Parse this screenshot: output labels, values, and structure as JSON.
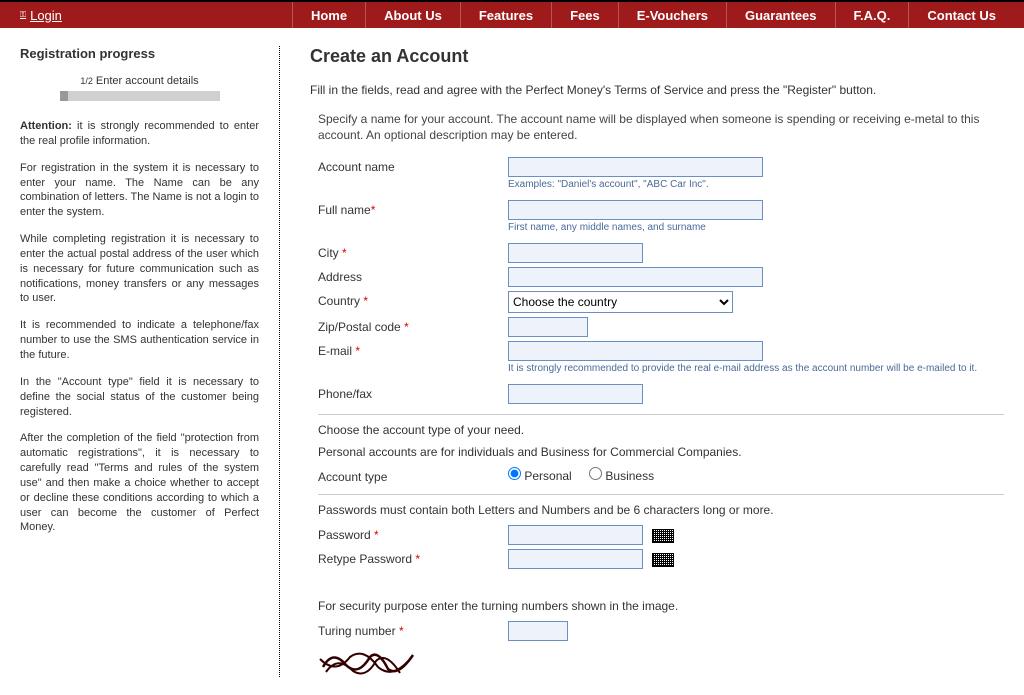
{
  "topbar": {
    "login": "Login",
    "nav": [
      "Home",
      "About Us",
      "Features",
      "Fees",
      "E-Vouchers",
      "Guarantees",
      "F.A.Q.",
      "Contact Us"
    ]
  },
  "sidebar": {
    "heading": "Registration progress",
    "step_fraction": "1/2",
    "step_label": "Enter account details",
    "paragraphs": {
      "attention_label": "Attention:",
      "attention_text": " it is strongly recommended to enter the real profile information.",
      "p2": "For registration in the system it is necessary to enter your name. The Name can be any combination of letters. The Name is not a login to enter the system.",
      "p3": "While completing registration it is necessary to enter the actual postal address of the user which is necessary for future communication such as notifications, money transfers or any messages to user.",
      "p4": "It is recommended to indicate a telephone/fax number to use the SMS authentication service in the future.",
      "p5": "In the \"Account type\" field it is necessary to define the social status of the customer being registered.",
      "p6": "After the completion of the field \"protection from automatic registrations\", it is necessary to carefully read \"Terms and rules of the system use\" and then make a choice whether to accept or decline these conditions according to which a user can become the customer of Perfect Money."
    }
  },
  "form": {
    "title": "Create an Account",
    "intro": "Fill in the fields, read and agree with the Perfect Money's Terms of Service and press the \"Register\" button.",
    "section_account_note": "Specify a name for your account. The account name will be displayed when someone is spending or receiving e-metal to this account. An optional description may be entered.",
    "labels": {
      "account_name": "Account name",
      "full_name": "Full name",
      "city": "City",
      "address": "Address",
      "country": "Country",
      "zip": "Zip/Postal code",
      "email": "E-mail",
      "phone": "Phone/fax",
      "account_type": "Account type",
      "password": "Password",
      "retype_password": "Retype Password",
      "turing": "Turing number"
    },
    "hints": {
      "account_name": "Examples: \"Daniel's account\", \"ABC Car Inc\".",
      "full_name": "First name, any middle names, and surname",
      "email": "It is strongly recommended to provide the real e-mail address as the account number will be e-mailed to it."
    },
    "country_placeholder": "Choose the country",
    "account_type_section": "Choose the account type of your need.",
    "account_type_desc": "Personal accounts are for individuals and Business for Commercial Companies.",
    "account_type_options": {
      "personal": "Personal",
      "business": "Business"
    },
    "password_section": "Passwords must contain both Letters and Numbers and be 6 characters long or more.",
    "turing_section": "For security purpose enter the turning numbers shown in the image.",
    "required_mark": "*"
  }
}
